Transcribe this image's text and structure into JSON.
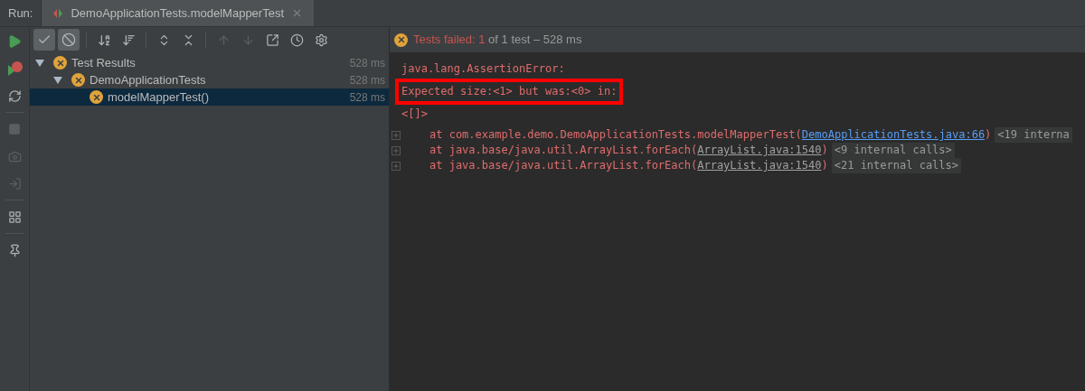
{
  "run_label": "Run:",
  "tab": {
    "title": "DemoApplicationTests.modelMapperTest",
    "selected": true
  },
  "toolbar_toggles": [
    {
      "kind": "passed",
      "on": true
    },
    {
      "kind": "ignored",
      "on": true
    }
  ],
  "tree": [
    {
      "label": "Test Results",
      "time": "528 ms",
      "selected": false,
      "expanded": true,
      "children": [
        {
          "label": "DemoApplicationTests",
          "time": "528 ms",
          "selected": false,
          "expanded": true,
          "children": [
            {
              "label": "modelMapperTest()",
              "time": "528 ms",
              "selected": true
            }
          ]
        }
      ]
    }
  ],
  "status": {
    "failed_label": "Tests failed: ",
    "failed_count": "1",
    "rest": " of 1 test – 528 ms"
  },
  "console": {
    "lines": [
      {
        "text": "java.lang.AssertionError:",
        "highlighted": false
      },
      {
        "text": "Expected size:<1> but was:<0> in:",
        "highlighted": true
      },
      {
        "text": "<[]>",
        "highlighted": false
      }
    ],
    "frames": [
      {
        "prefix": "at com.example.demo.DemoApplicationTests.modelMapperTest(",
        "link": "DemoApplicationTests.java:66",
        "kind": "source",
        "suffix": ")",
        "folded": "<19 interna"
      },
      {
        "prefix": "at java.base/java.util.ArrayList.forEach(",
        "link": "ArrayList.java:1540",
        "kind": "library",
        "suffix": ")",
        "folded": "<9 internal calls>"
      },
      {
        "prefix": "at java.base/java.util.ArrayList.forEach(",
        "link": "ArrayList.java:1540",
        "kind": "library",
        "suffix": ")",
        "folded": "<21 internal calls>"
      }
    ]
  }
}
